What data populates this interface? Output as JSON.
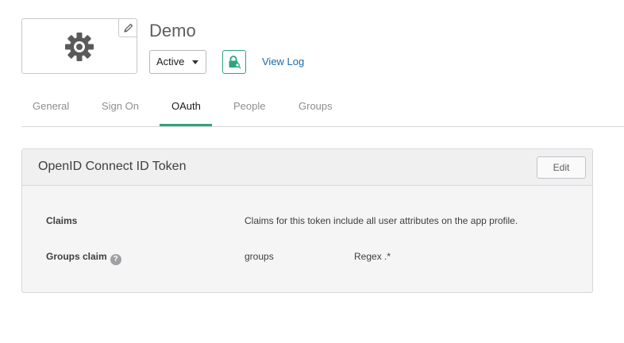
{
  "app": {
    "title": "Demo",
    "status": "Active",
    "view_log": "View Log"
  },
  "tabs": [
    {
      "label": "General"
    },
    {
      "label": "Sign On"
    },
    {
      "label": "OAuth"
    },
    {
      "label": "People"
    },
    {
      "label": "Groups"
    }
  ],
  "active_tab": "OAuth",
  "panel": {
    "title": "OpenID Connect ID Token",
    "edit_label": "Edit",
    "rows": [
      {
        "label": "Claims",
        "value": "Claims for this token include all user attributes on the app profile."
      },
      {
        "label": "Groups claim",
        "help": "?",
        "value": "groups",
        "filter": "Regex .*"
      }
    ]
  },
  "colors": {
    "accent": "#2ba57a",
    "link": "#1a6aa8"
  },
  "icons": {
    "logo": "gear-icon",
    "edit_logo": "pencil-icon",
    "push": "lock-key-icon",
    "status_caret": "caret-down-icon",
    "help": "help-icon"
  }
}
